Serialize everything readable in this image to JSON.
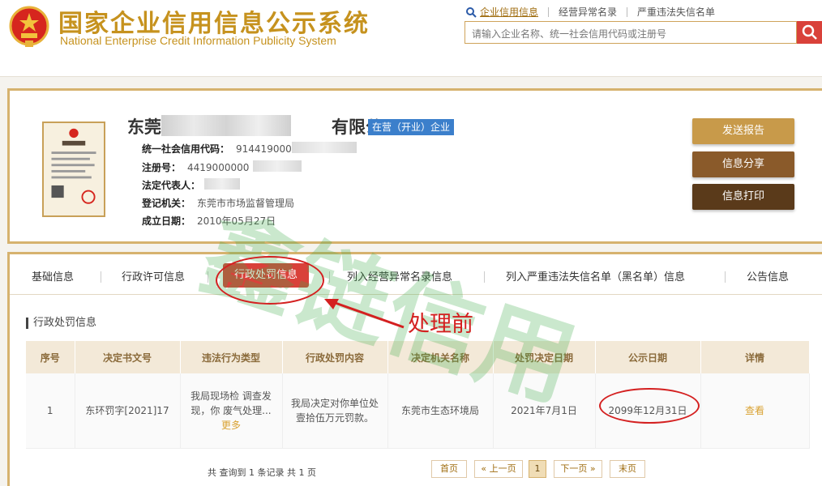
{
  "header": {
    "title": "国家企业信用信息公示系统",
    "subtitle": "National Enterprise Credit Information Publicity System",
    "links": [
      "企业信用信息",
      "经营异常名录",
      "严重违法失信名单"
    ],
    "search_placeholder": "请输入企业名称、统一社会信用代码或注册号"
  },
  "company": {
    "name_prefix": "东莞",
    "name_suffix": "有限公司",
    "status": "在营（开业）企业",
    "fields": [
      {
        "label": "统一社会信用代码：",
        "value": "914419000"
      },
      {
        "label": "注册号：",
        "value": "4419000000"
      },
      {
        "label": "法定代表人：",
        "value": ""
      },
      {
        "label": "登记机关：",
        "value": "东莞市市场监督管理局"
      },
      {
        "label": "成立日期：",
        "value": "2010年05月27日"
      }
    ],
    "actions": [
      "发送报告",
      "信息分享",
      "信息打印"
    ],
    "colors": {
      "badge": "#3b7fcb",
      "btn1": "#c89a4a",
      "btn2": "#8a5a2a",
      "btn3": "#5a3a1a"
    }
  },
  "tabs": [
    "基础信息",
    "行政许可信息",
    "行政处罚信息",
    "列入经营异常名录信息",
    "列入严重违法失信名单（黑名单）信息",
    "公告信息"
  ],
  "section_title": "行政处罚信息",
  "table": {
    "headers": [
      "序号",
      "决定书文号",
      "违法行为类型",
      "行政处罚内容",
      "决定机关名称",
      "处罚决定日期",
      "公示日期",
      "详情"
    ],
    "rows": [
      {
        "index": "1",
        "doc_no": "东环罚字[2021]17",
        "violation": "我局现场检  调查发现，你  废气处理...",
        "violation_more": "更多",
        "penalty": "我局决定对你单位处壹拾伍万元罚款。",
        "authority": "东莞市生态环境局",
        "decision_date": "2021年7月1日",
        "publish_date": "2099年12月31日",
        "detail": "查看"
      }
    ]
  },
  "pager": {
    "summary": "共 查询到 1 条记录 共 1 页",
    "first": "首页",
    "prev": "« 上一页",
    "current": "1",
    "next": "下一页 »",
    "last": "末页"
  },
  "annotation": "处理前",
  "watermark": "鑫链信用",
  "icons": {
    "search": "search-icon",
    "emblem": "national-emblem-icon",
    "arrow": "annotation-arrow-icon"
  }
}
